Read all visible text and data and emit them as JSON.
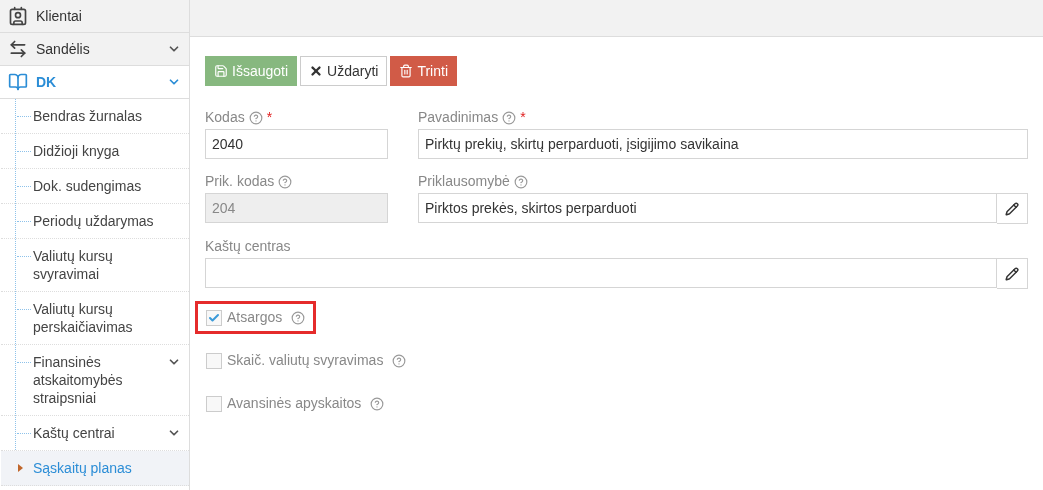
{
  "sidebar": {
    "items": [
      {
        "label": "Klientai",
        "active": false,
        "has_children": false
      },
      {
        "label": "Sandėlis",
        "active": false,
        "has_children": true
      },
      {
        "label": "DK",
        "active": true,
        "has_children": true,
        "children": [
          {
            "label": "Bendras žurnalas",
            "has_children": false,
            "selected": false
          },
          {
            "label": "Didžioji knyga",
            "has_children": false,
            "selected": false
          },
          {
            "label": "Dok. sudengimas",
            "has_children": false,
            "selected": false
          },
          {
            "label": "Periodų uždarymas",
            "has_children": false,
            "selected": false
          },
          {
            "label": "Valiutų kursų svyravimai",
            "has_children": false,
            "selected": false
          },
          {
            "label": "Valiutų kursų perskaičiavimas",
            "has_children": false,
            "selected": false
          },
          {
            "label": "Finansinės atskaitomybės straipsniai",
            "has_children": true,
            "selected": false
          },
          {
            "label": "Kaštų centrai",
            "has_children": true,
            "selected": false
          },
          {
            "label": "Sąskaitų planas",
            "has_children": false,
            "selected": true
          }
        ]
      }
    ]
  },
  "toolbar": {
    "buttons": [
      {
        "kind": "save",
        "label": "Išsaugoti"
      },
      {
        "kind": "close",
        "label": "Uždaryti"
      },
      {
        "kind": "delete",
        "label": "Trinti"
      }
    ]
  },
  "form": {
    "field_rows": [
      [
        {
          "label": "Kodas",
          "help": true,
          "required_mark": "*",
          "disabled": false,
          "editable": false,
          "value": "2040"
        },
        {
          "label": "Pavadinimas",
          "help": true,
          "required_mark": "*",
          "disabled": false,
          "editable": false,
          "value": "Pirktų prekių, skirtų perparduoti, įsigijimo savikaina"
        }
      ],
      [
        {
          "label": "Prik. kodas",
          "help": true,
          "disabled": true,
          "editable": false,
          "value": "204"
        },
        {
          "label": "Priklausomybė",
          "help": true,
          "disabled": false,
          "editable": true,
          "value": "Pirktos prekės, skirtos perparduoti"
        }
      ],
      [
        {
          "label": "Kaštų centras",
          "help": false,
          "disabled": false,
          "editable": true
        }
      ]
    ],
    "checkboxes": [
      {
        "label": "Atsargos",
        "checked": true,
        "highlighted": true
      },
      {
        "label": "Skaič. valiutų svyravimas",
        "checked": false,
        "highlighted": false
      },
      {
        "label": "Avansinės apyskaitos",
        "checked": false,
        "highlighted": false
      }
    ]
  }
}
